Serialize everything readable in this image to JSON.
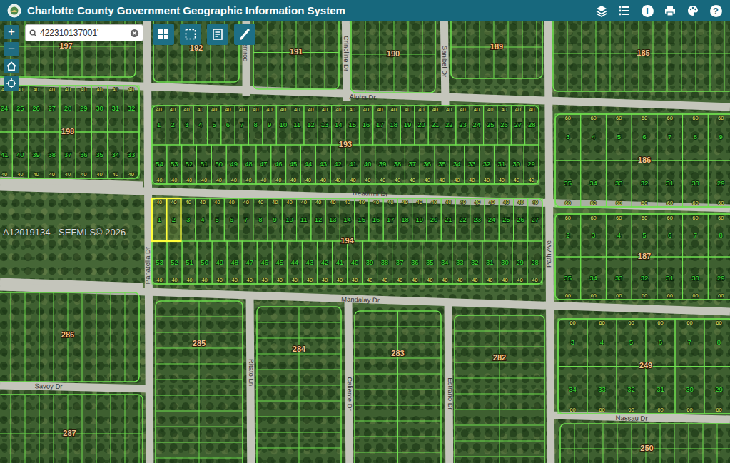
{
  "header": {
    "title": "Charlotte County Government Geographic Information System",
    "buttons": [
      {
        "kind": "layers"
      },
      {
        "kind": "list"
      },
      {
        "kind": "info",
        "glyph": "i"
      },
      {
        "kind": "print"
      },
      {
        "kind": "palette"
      },
      {
        "kind": "help",
        "glyph": "?"
      }
    ]
  },
  "controls": {
    "zoom_in": "+",
    "zoom_out": "−"
  },
  "search": {
    "value": "422310137001'"
  },
  "tools": [
    {
      "kind": "grid"
    },
    {
      "kind": "select"
    },
    {
      "kind": "notes"
    },
    {
      "kind": "measure"
    }
  ],
  "watermark": "A12019134 - SEFMLS© 2026",
  "streets": [
    {
      "name": "Aloha Dr"
    },
    {
      "name": "Treadmill Dr"
    },
    {
      "name": "Mandalay Dr"
    },
    {
      "name": "Savoy Dr"
    },
    {
      "name": "Nassau Dr"
    },
    {
      "name": "Panatella Dr"
    },
    {
      "name": "Path Ave"
    },
    {
      "name": "Pemrod"
    },
    {
      "name": "Crinoline Dr"
    },
    {
      "name": "Sanibel Dr"
    },
    {
      "name": "Ritato Ln"
    },
    {
      "name": "Caliente Dr"
    },
    {
      "name": "Estrano Dr"
    }
  ],
  "blocks": [
    {
      "number": "193",
      "frontage": "40",
      "top": [
        {
          "n": "1",
          "selected": false
        },
        {
          "n": "2",
          "selected": false
        },
        {
          "n": "3",
          "selected": false
        },
        {
          "n": "4",
          "selected": false
        },
        {
          "n": "5",
          "selected": false
        },
        {
          "n": "6",
          "selected": false
        },
        {
          "n": "7",
          "selected": false
        },
        {
          "n": "8",
          "selected": false
        },
        {
          "n": "9",
          "selected": false
        },
        {
          "n": "10",
          "selected": false
        },
        {
          "n": "11",
          "selected": false
        },
        {
          "n": "12",
          "selected": false
        },
        {
          "n": "13",
          "selected": false
        },
        {
          "n": "14",
          "selected": false
        },
        {
          "n": "15",
          "selected": false
        },
        {
          "n": "16",
          "selected": false
        },
        {
          "n": "17",
          "selected": false
        },
        {
          "n": "18",
          "selected": false
        },
        {
          "n": "19",
          "selected": false
        },
        {
          "n": "20",
          "selected": false
        },
        {
          "n": "21",
          "selected": false
        },
        {
          "n": "22",
          "selected": false
        },
        {
          "n": "23",
          "selected": false
        },
        {
          "n": "24",
          "selected": false
        },
        {
          "n": "25",
          "selected": false
        },
        {
          "n": "26",
          "selected": false
        },
        {
          "n": "27",
          "selected": false
        },
        {
          "n": "28",
          "selected": false
        }
      ],
      "bottom": [
        {
          "n": "54",
          "selected": false
        },
        {
          "n": "53",
          "selected": false
        },
        {
          "n": "52",
          "selected": false
        },
        {
          "n": "51",
          "selected": false
        },
        {
          "n": "50",
          "selected": false
        },
        {
          "n": "49",
          "selected": false
        },
        {
          "n": "48",
          "selected": false
        },
        {
          "n": "47",
          "selected": false
        },
        {
          "n": "46",
          "selected": false
        },
        {
          "n": "45",
          "selected": false
        },
        {
          "n": "44",
          "selected": false
        },
        {
          "n": "43",
          "selected": false
        },
        {
          "n": "42",
          "selected": false
        },
        {
          "n": "41",
          "selected": false
        },
        {
          "n": "40",
          "selected": false
        },
        {
          "n": "39",
          "selected": false
        },
        {
          "n": "38",
          "selected": false
        },
        {
          "n": "37",
          "selected": false
        },
        {
          "n": "36",
          "selected": false
        },
        {
          "n": "35",
          "selected": false
        },
        {
          "n": "34",
          "selected": false
        },
        {
          "n": "33",
          "selected": false
        },
        {
          "n": "32",
          "selected": false
        },
        {
          "n": "31",
          "selected": false
        },
        {
          "n": "30",
          "selected": false
        },
        {
          "n": "29",
          "selected": false
        }
      ]
    },
    {
      "number": "194",
      "frontage": "40",
      "top": [
        {
          "n": "1",
          "selected": true
        },
        {
          "n": "2",
          "selected": true
        },
        {
          "n": "3",
          "selected": false
        },
        {
          "n": "4",
          "selected": false
        },
        {
          "n": "5",
          "selected": false
        },
        {
          "n": "6",
          "selected": false
        },
        {
          "n": "7",
          "selected": false
        },
        {
          "n": "8",
          "selected": false
        },
        {
          "n": "9",
          "selected": false
        },
        {
          "n": "10",
          "selected": false
        },
        {
          "n": "11",
          "selected": false
        },
        {
          "n": "12",
          "selected": false
        },
        {
          "n": "13",
          "selected": false
        },
        {
          "n": "14",
          "selected": false
        },
        {
          "n": "15",
          "selected": false
        },
        {
          "n": "16",
          "selected": false
        },
        {
          "n": "17",
          "selected": false
        },
        {
          "n": "18",
          "selected": false
        },
        {
          "n": "19",
          "selected": false
        },
        {
          "n": "20",
          "selected": false
        },
        {
          "n": "21",
          "selected": false
        },
        {
          "n": "22",
          "selected": false
        },
        {
          "n": "23",
          "selected": false
        },
        {
          "n": "24",
          "selected": false
        },
        {
          "n": "25",
          "selected": false
        },
        {
          "n": "26",
          "selected": false
        },
        {
          "n": "27",
          "selected": false
        }
      ],
      "bottom": [
        {
          "n": "53",
          "selected": false
        },
        {
          "n": "52",
          "selected": false
        },
        {
          "n": "51",
          "selected": false
        },
        {
          "n": "50",
          "selected": false
        },
        {
          "n": "49",
          "selected": false
        },
        {
          "n": "48",
          "selected": false
        },
        {
          "n": "47",
          "selected": false
        },
        {
          "n": "46",
          "selected": false
        },
        {
          "n": "45",
          "selected": false
        },
        {
          "n": "44",
          "selected": false
        },
        {
          "n": "43",
          "selected": false
        },
        {
          "n": "42",
          "selected": false
        },
        {
          "n": "41",
          "selected": false
        },
        {
          "n": "40",
          "selected": false
        },
        {
          "n": "39",
          "selected": false
        },
        {
          "n": "38",
          "selected": false
        },
        {
          "n": "37",
          "selected": false
        },
        {
          "n": "36",
          "selected": false
        },
        {
          "n": "35",
          "selected": false
        },
        {
          "n": "34",
          "selected": false
        },
        {
          "n": "33",
          "selected": false
        },
        {
          "n": "32",
          "selected": false
        },
        {
          "n": "31",
          "selected": false
        },
        {
          "n": "30",
          "selected": false
        },
        {
          "n": "29",
          "selected": false
        },
        {
          "n": "28",
          "selected": false
        }
      ]
    },
    {
      "number": "198",
      "frontage": "40",
      "top": [
        {
          "n": "24",
          "selected": false
        },
        {
          "n": "25",
          "selected": false
        },
        {
          "n": "26",
          "selected": false
        },
        {
          "n": "27",
          "selected": false
        },
        {
          "n": "28",
          "selected": false
        },
        {
          "n": "29",
          "selected": false
        },
        {
          "n": "30",
          "selected": false
        },
        {
          "n": "31",
          "selected": false
        },
        {
          "n": "32",
          "selected": false
        }
      ],
      "bottom": [
        {
          "n": "41",
          "selected": false
        },
        {
          "n": "40",
          "selected": false
        },
        {
          "n": "39",
          "selected": false
        },
        {
          "n": "38",
          "selected": false
        },
        {
          "n": "37",
          "selected": false
        },
        {
          "n": "36",
          "selected": false
        },
        {
          "n": "35",
          "selected": false
        },
        {
          "n": "34",
          "selected": false
        },
        {
          "n": "33",
          "selected": false
        }
      ]
    },
    {
      "number": "186",
      "frontage": "60",
      "top": [
        {
          "n": "3",
          "selected": false
        },
        {
          "n": "4",
          "selected": false
        },
        {
          "n": "5",
          "selected": false
        },
        {
          "n": "6",
          "selected": false
        },
        {
          "n": "7",
          "selected": false
        },
        {
          "n": "8",
          "selected": false
        },
        {
          "n": "9",
          "selected": false
        }
      ],
      "bottom": [
        {
          "n": "35",
          "selected": false
        },
        {
          "n": "34",
          "selected": false
        },
        {
          "n": "33",
          "selected": false
        },
        {
          "n": "32",
          "selected": false
        },
        {
          "n": "31",
          "selected": false
        },
        {
          "n": "30",
          "selected": false
        },
        {
          "n": "29",
          "selected": false
        }
      ]
    },
    {
      "number": "187",
      "frontage": "60",
      "top": [
        {
          "n": "2",
          "selected": false
        },
        {
          "n": "3",
          "selected": false
        },
        {
          "n": "4",
          "selected": false
        },
        {
          "n": "5",
          "selected": false
        },
        {
          "n": "6",
          "selected": false
        },
        {
          "n": "7",
          "selected": false
        },
        {
          "n": "8",
          "selected": false
        }
      ],
      "bottom": [
        {
          "n": "35",
          "selected": false
        },
        {
          "n": "34",
          "selected": false
        },
        {
          "n": "33",
          "selected": false
        },
        {
          "n": "32",
          "selected": false
        },
        {
          "n": "31",
          "selected": false
        },
        {
          "n": "30",
          "selected": false
        },
        {
          "n": "29",
          "selected": false
        }
      ]
    },
    {
      "number": "249",
      "frontage": "60",
      "top": [
        {
          "n": "3",
          "selected": false
        },
        {
          "n": "4",
          "selected": false
        },
        {
          "n": "5",
          "selected": false
        },
        {
          "n": "6",
          "selected": false
        },
        {
          "n": "7",
          "selected": false
        },
        {
          "n": "8",
          "selected": false
        }
      ],
      "bottom": [
        {
          "n": "34",
          "selected": false
        },
        {
          "n": "33",
          "selected": false
        },
        {
          "n": "32",
          "selected": false
        },
        {
          "n": "31",
          "selected": false
        },
        {
          "n": "30",
          "selected": false
        },
        {
          "n": "29",
          "selected": false
        }
      ]
    },
    {
      "number": "185"
    },
    {
      "number": "189"
    },
    {
      "number": "190"
    },
    {
      "number": "191"
    },
    {
      "number": "192"
    },
    {
      "number": "197"
    },
    {
      "number": "286"
    },
    {
      "number": "285"
    },
    {
      "number": "284"
    },
    {
      "number": "283"
    },
    {
      "number": "282"
    },
    {
      "number": "250"
    },
    {
      "number": "287"
    }
  ]
}
